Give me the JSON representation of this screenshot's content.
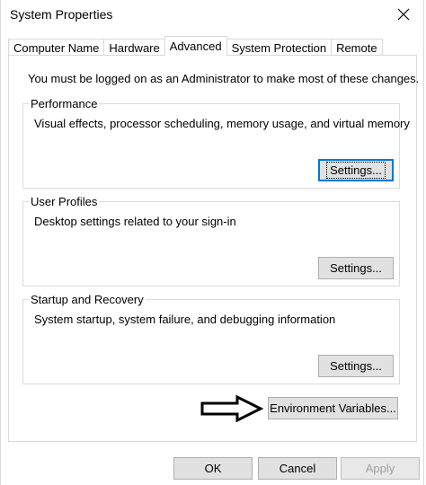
{
  "window": {
    "title": "System Properties"
  },
  "tabs": [
    {
      "label": "Computer Name",
      "active": false
    },
    {
      "label": "Hardware",
      "active": false
    },
    {
      "label": "Advanced",
      "active": true
    },
    {
      "label": "System Protection",
      "active": false
    },
    {
      "label": "Remote",
      "active": false
    }
  ],
  "advanced": {
    "admin_note": "You must be logged on as an Administrator to make most of these changes.",
    "performance": {
      "legend": "Performance",
      "description": "Visual effects, processor scheduling, memory usage, and virtual memory",
      "button": "Settings..."
    },
    "user_profiles": {
      "legend": "User Profiles",
      "description": "Desktop settings related to your sign-in",
      "button": "Settings..."
    },
    "startup_recovery": {
      "legend": "Startup and Recovery",
      "description": "System startup, system failure, and debugging information",
      "button": "Settings..."
    },
    "env_button": "Environment Variables..."
  },
  "footer": {
    "ok": "OK",
    "cancel": "Cancel",
    "apply": "Apply"
  },
  "icons": {
    "close": "close-icon",
    "arrow": "arrow-right-icon"
  },
  "colors": {
    "focus_border": "#0078d7",
    "button_bg": "#e1e1e1",
    "disabled_text": "#a0a0a0"
  }
}
